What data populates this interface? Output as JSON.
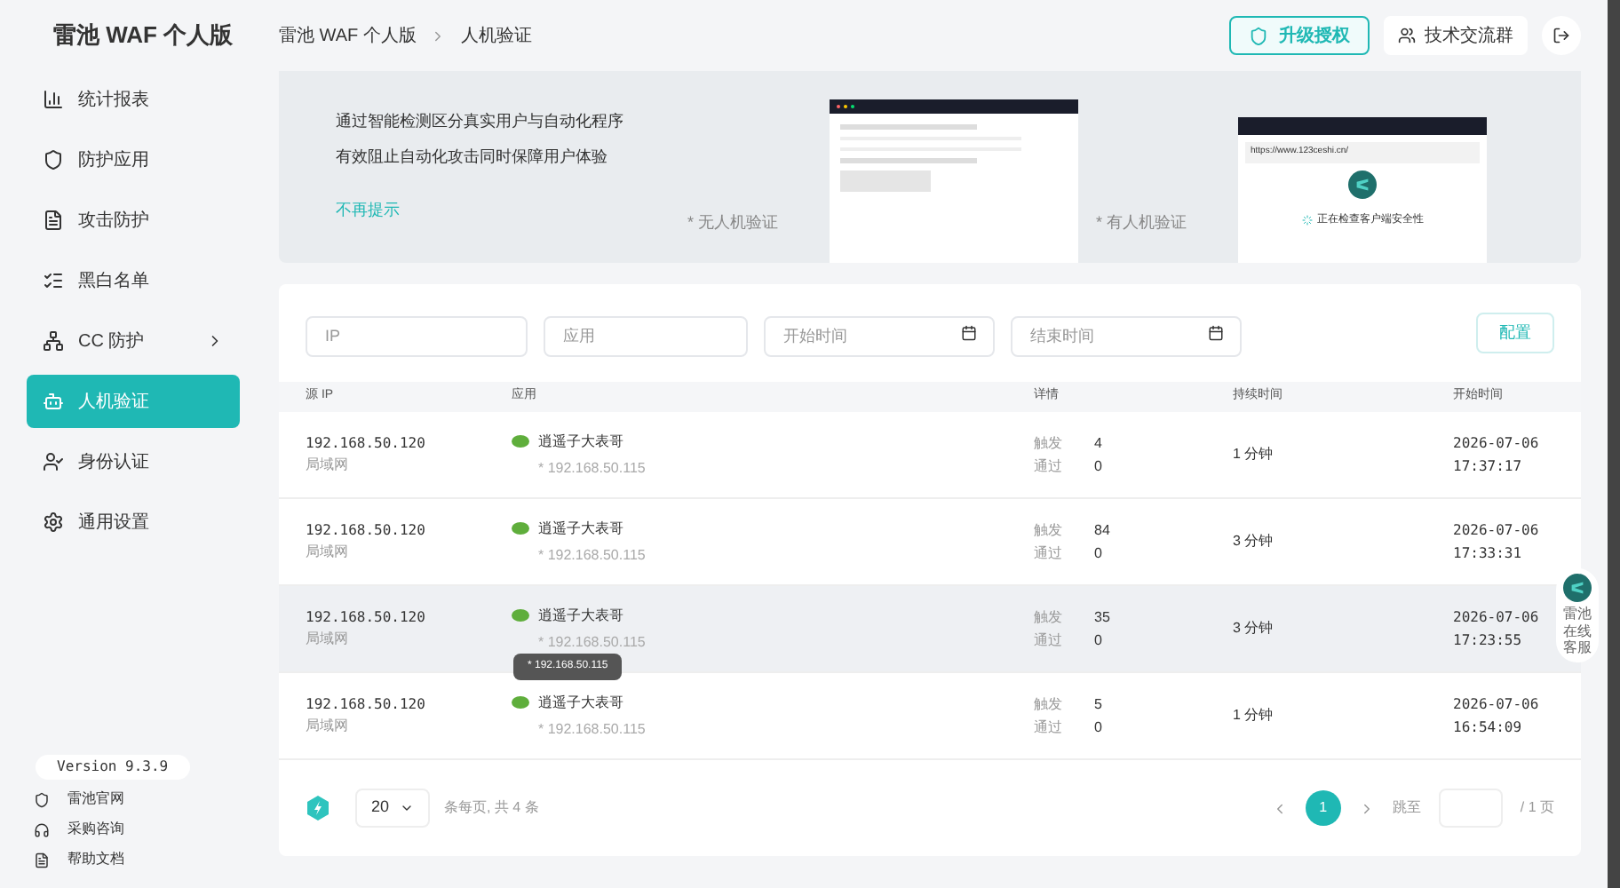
{
  "brand": {
    "title": "雷池 WAF 个人版"
  },
  "breadcrumb": [
    "雷池 WAF 个人版",
    "人机验证"
  ],
  "header_buttons": [
    {
      "kind": "upgrade",
      "label": "升级授权"
    },
    {
      "kind": "group",
      "label": "技术交流群"
    },
    {
      "kind": "logout"
    }
  ],
  "sidebar": {
    "items": [
      {
        "label": "统计报表",
        "selected": false,
        "expandable": false
      },
      {
        "label": "防护应用",
        "selected": false,
        "expandable": false
      },
      {
        "label": "攻击防护",
        "selected": false,
        "expandable": false
      },
      {
        "label": "黑白名单",
        "selected": false,
        "expandable": false
      },
      {
        "label": "CC 防护",
        "selected": false,
        "expandable": true
      },
      {
        "label": "人机验证",
        "selected": true,
        "expandable": false
      },
      {
        "label": "身份认证",
        "selected": false,
        "expandable": false
      },
      {
        "label": "通用设置",
        "selected": false,
        "expandable": false
      }
    ],
    "version": "Version 9.3.9",
    "links": [
      "雷池官网",
      "采购咨询",
      "帮助文档"
    ]
  },
  "banner": {
    "lines": [
      "通过智能检测区分真实用户与自动化程序",
      "有效阻止自动化攻击同时保障用户体验"
    ],
    "dismiss": "不再提示",
    "caption_without": "* 无人机验证",
    "caption_with": "* 有人机验证",
    "url": "https://www.123ceshi.cn/",
    "checking": "正在检查客户端安全性"
  },
  "filters": [
    {
      "placeholder": "IP",
      "kind": "text"
    },
    {
      "placeholder": "应用",
      "kind": "text"
    },
    {
      "placeholder": "开始时间",
      "kind": "date"
    },
    {
      "placeholder": "结束时间",
      "kind": "date"
    }
  ],
  "config_button": "配置",
  "table": {
    "columns": [
      "源 IP",
      "应用",
      "详情",
      "持续时间",
      "开始时间"
    ],
    "rows": [
      {
        "ip": "192.168.50.120",
        "network": "局域网",
        "app": "逍遥子大表哥",
        "app_host": "* 192.168.50.115",
        "trigger_label": "触发",
        "trigger": "4",
        "pass_label": "通过",
        "pass": "0",
        "duration": "1 分钟",
        "date": "2026-07-06",
        "time": "17:37:17",
        "hovered": false
      },
      {
        "ip": "192.168.50.120",
        "network": "局域网",
        "app": "逍遥子大表哥",
        "app_host": "* 192.168.50.115",
        "trigger_label": "触发",
        "trigger": "84",
        "pass_label": "通过",
        "pass": "0",
        "duration": "3 分钟",
        "date": "2026-07-06",
        "time": "17:33:31",
        "hovered": false
      },
      {
        "ip": "192.168.50.120",
        "network": "局域网",
        "app": "逍遥子大表哥",
        "app_host": "* 192.168.50.115",
        "trigger_label": "触发",
        "trigger": "35",
        "pass_label": "通过",
        "pass": "0",
        "duration": "3 分钟",
        "date": "2026-07-06",
        "time": "17:23:55",
        "hovered": true
      },
      {
        "ip": "192.168.50.120",
        "network": "局域网",
        "app": "逍遥子大表哥",
        "app_host": "* 192.168.50.115",
        "trigger_label": "触发",
        "trigger": "5",
        "pass_label": "通过",
        "pass": "0",
        "duration": "1 分钟",
        "date": "2026-07-06",
        "time": "16:54:09",
        "hovered": false
      }
    ]
  },
  "tooltip": "* 192.168.50.115",
  "pagination": {
    "page_size": "20",
    "summary": "条每页, 共 4 条",
    "pages": [
      {
        "label": "1",
        "selected": true
      }
    ],
    "jump_label": "跳至",
    "total": "/ 1 页"
  },
  "support": {
    "label": "雷池在线客服"
  }
}
